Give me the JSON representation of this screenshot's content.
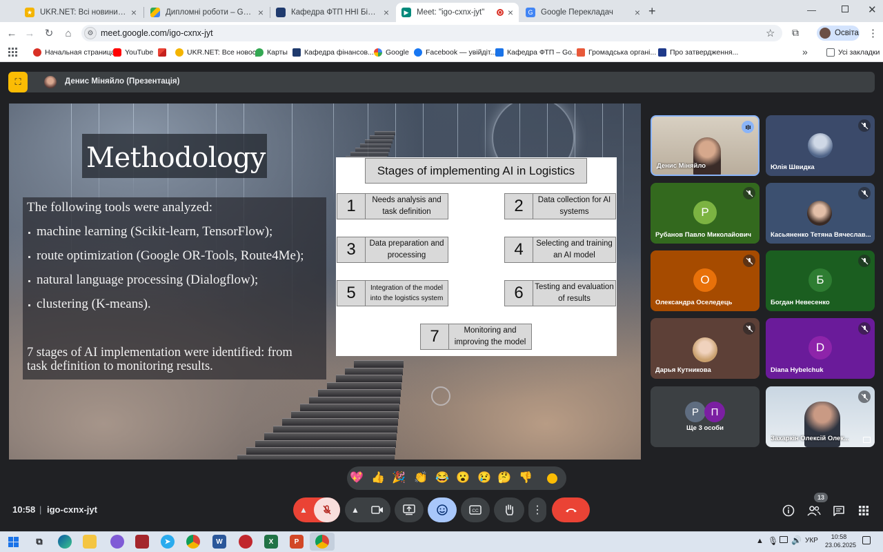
{
  "browser": {
    "tabs": [
      {
        "title": "UKR.NET: Всі новини України, о",
        "icon": "ukrnet-icon",
        "color": "#f4b400"
      },
      {
        "title": "Дипломні роботи – Google Ди",
        "icon": "google-drive-icon",
        "color": "#1a73e8"
      },
      {
        "title": "Кафедра ФТП ННІ БіЕМ СумДУ",
        "icon": "sumdu-icon",
        "color": "#1f3a6d"
      },
      {
        "title": "Meet: \"igo-cxnx-jyt\"",
        "icon": "google-meet-icon",
        "color": "#00897b"
      },
      {
        "title": "Google Перекладач",
        "icon": "google-translate-icon",
        "color": "#4285f4"
      }
    ],
    "new_tab": "+",
    "url": "meet.google.com/igo-cxnx-jyt",
    "profile": "Освіта",
    "bookmarks": [
      {
        "label": "Начальная страница",
        "color": "#d93025"
      },
      {
        "label": "YouTube",
        "color": "#ff0000"
      },
      {
        "label": "",
        "color": "#ea4335"
      },
      {
        "label": "UKR.NET: Все новос...",
        "color": "#f4b400"
      },
      {
        "label": "Карты",
        "color": "#34a853"
      },
      {
        "label": "Кафедра фінансов...",
        "color": "#1f3a6d"
      },
      {
        "label": "Google",
        "color": "#4285f4"
      },
      {
        "label": "Facebook — увійдіт...",
        "color": "#1877f2"
      },
      {
        "label": "Кафедра ФТП – Go...",
        "color": "#1a73e8"
      },
      {
        "label": "Громадська органі...",
        "color": "#e8593a"
      },
      {
        "label": "Про затвердження...",
        "color": "#1f3a8a"
      }
    ],
    "all_bookmarks": "Усі закладки"
  },
  "meet": {
    "presenter": "Денис Міняйло (Презентація)",
    "time": "10:58",
    "separator": "|",
    "code": "igo-cxnx-jyt",
    "participants_count": "13",
    "participants": [
      {
        "name": "Денис Міняйло",
        "type": "photo",
        "speaking": true
      },
      {
        "name": "Юлія Швидка",
        "type": "avatar",
        "bg": "#3b4a6a"
      },
      {
        "name": "Рубанов Павло Миколайович",
        "type": "letter",
        "letter": "Р",
        "bg": "#33691e",
        "circle": "#7cb342"
      },
      {
        "name": "Касьяненко Тетяна Вячеслав...",
        "type": "avatar",
        "bg": "#3c5070"
      },
      {
        "name": "Олександра Оселедець",
        "type": "letter",
        "letter": "О",
        "bg": "#a64b00",
        "circle": "#e8710a"
      },
      {
        "name": "Богдан Невесенко",
        "type": "letter",
        "letter": "Б",
        "bg": "#1b5e20",
        "circle": "#2e7d32"
      },
      {
        "name": "Дарья Кутникова",
        "type": "avatar",
        "bg": "#5d4037"
      },
      {
        "name": "Diana Hybelchuk",
        "type": "letter",
        "letter": "D",
        "bg": "#6a1b9a",
        "circle": "#8e24aa"
      },
      {
        "name": "Ще 3 особи",
        "type": "group",
        "letters": [
          "Р",
          "П"
        ]
      },
      {
        "name": "Захаркін Олексій Олек...",
        "type": "photo2"
      }
    ],
    "reactions": [
      "💖",
      "👍",
      "🎉",
      "👏",
      "😂",
      "😮",
      "😢",
      "🤔",
      "👎"
    ]
  },
  "slide": {
    "title": "Methodology",
    "intro": "The following tools were analyzed:",
    "tools": [
      "machine learning (Scikit-learn, TensorFlow);",
      "route optimization (Google OR-Tools, Route4Me);",
      "natural language processing (Dialogflow);",
      "clustering (K-means)."
    ],
    "conclusion": [
      "7 stages of AI implementation were identified: from",
      "task definition to monitoring results."
    ],
    "diagram": {
      "title": "Stages of implementing AI in Logistics",
      "stages": [
        {
          "num": "1",
          "label": "Needs analysis and task definition"
        },
        {
          "num": "2",
          "label": "Data collection for AI systems"
        },
        {
          "num": "3",
          "label": "Data preparation and processing"
        },
        {
          "num": "4",
          "label": "Selecting and training an AI model"
        },
        {
          "num": "5",
          "label": "Integration of the model into the logistics system"
        },
        {
          "num": "6",
          "label": "Testing and evaluation of results"
        },
        {
          "num": "7",
          "label": "Monitoring and improving the model"
        }
      ]
    }
  },
  "taskbar": {
    "lang": "УКР",
    "time": "10:58",
    "date": "23.06.2025"
  }
}
